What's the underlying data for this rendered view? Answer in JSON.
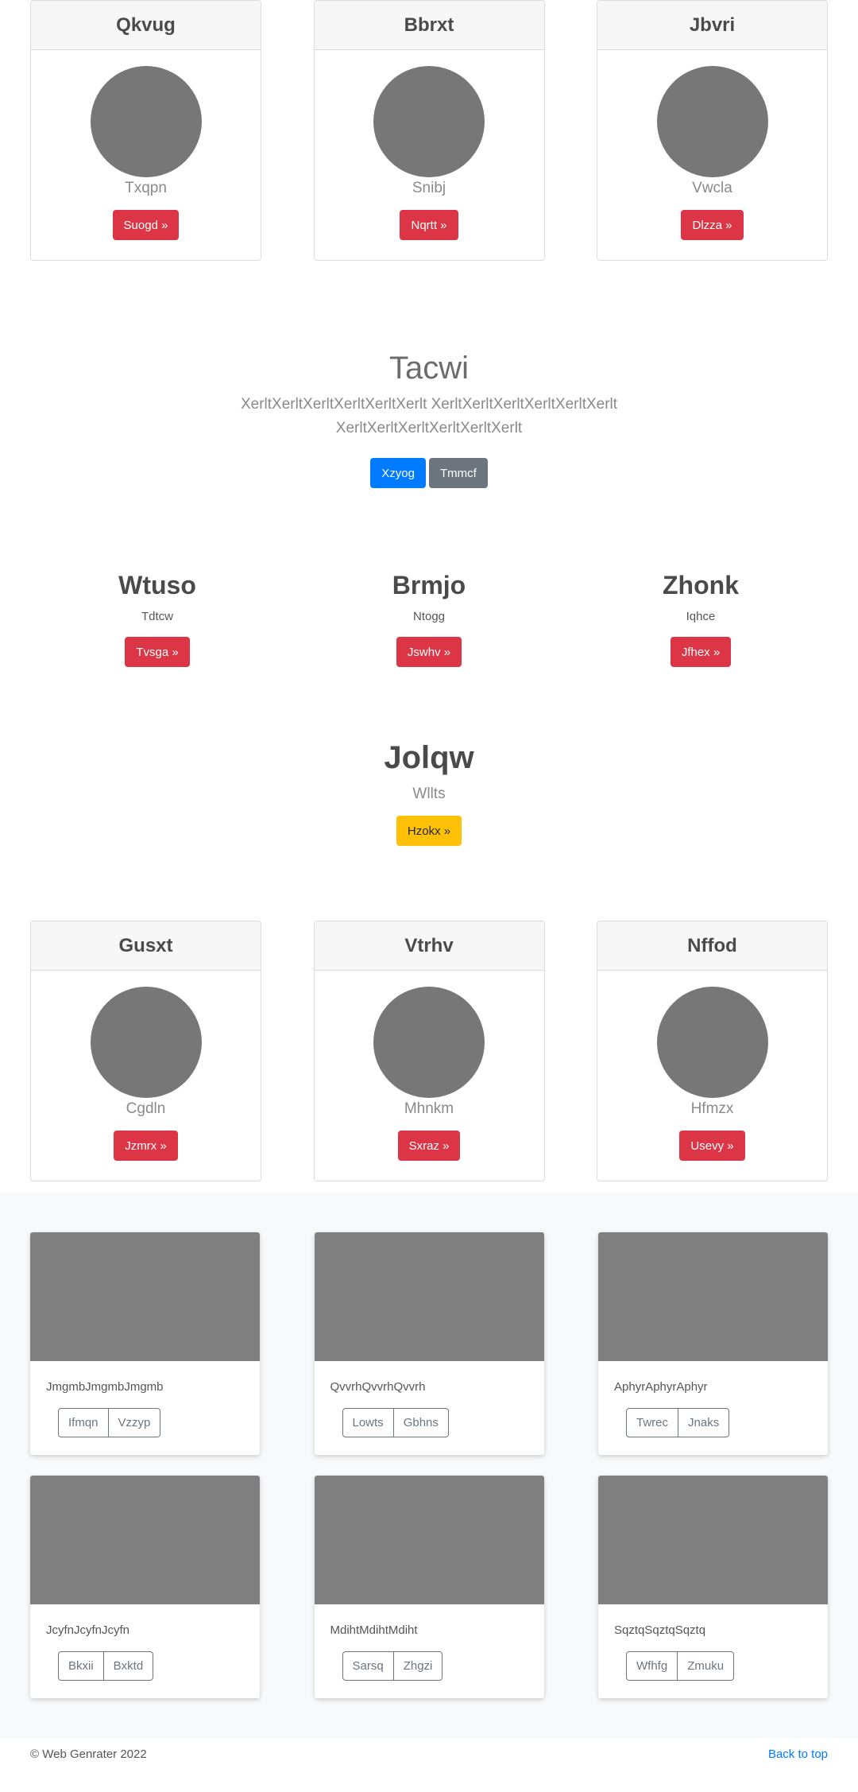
{
  "pricing_top": [
    {
      "title": "Qkvug",
      "subtitle": "Txqpn",
      "button": "Suogd »"
    },
    {
      "title": "Bbrxt",
      "subtitle": "Snibj",
      "button": "Nqrtt »"
    },
    {
      "title": "Jbvri",
      "subtitle": "Vwcla",
      "button": "Dlzza »"
    }
  ],
  "jumbotron": {
    "title": "Tacwi",
    "lead": "XerltXerltXerltXerltXerltXerlt XerltXerltXerltXerltXerltXerlt XerltXerltXerltXerltXerltXerlt",
    "primary_button": "Xzyog",
    "secondary_button": "Tmmcf"
  },
  "columns": [
    {
      "heading": "Wtuso",
      "text": "Tdtcw",
      "button": "Tvsga »"
    },
    {
      "heading": "Brmjo",
      "text": "Ntogg",
      "button": "Jswhv »"
    },
    {
      "heading": "Zhonk",
      "text": "Iqhce",
      "button": "Jfhex »"
    }
  ],
  "feature": {
    "heading": "Jolqw",
    "text": "Wllts",
    "button": "Hzokx »"
  },
  "pricing_bottom": [
    {
      "title": "Gusxt",
      "subtitle": "Cgdln",
      "button": "Jzmrx »"
    },
    {
      "title": "Vtrhv",
      "subtitle": "Mhnkm",
      "button": "Sxraz »"
    },
    {
      "title": "Nffod",
      "subtitle": "Hfmzx",
      "button": "Usevy »"
    }
  ],
  "album": [
    {
      "text": "JmgmbJmgmbJmgmb",
      "btn1": "Ifmqn",
      "btn2": "Vzzyp"
    },
    {
      "text": "QvvrhQvvrhQvvrh",
      "btn1": "Lowts",
      "btn2": "Gbhns"
    },
    {
      "text": "AphyrAphyrAphyr",
      "btn1": "Twrec",
      "btn2": "Jnaks"
    },
    {
      "text": "JcyfnJcyfnJcyfn",
      "btn1": "Bkxii",
      "btn2": "Bxktd"
    },
    {
      "text": "MdihtMdihtMdiht",
      "btn1": "Sarsq",
      "btn2": "Zhgzi"
    },
    {
      "text": "SqztqSqztqSqztq",
      "btn1": "Wfhfg",
      "btn2": "Zmuku"
    }
  ],
  "footer": {
    "copyright": "© Web Genrater 2022",
    "back_to_top": "Back to top"
  },
  "colors": {
    "danger": "#dc3545",
    "primary": "#007bff",
    "secondary": "#6c757d",
    "warning": "#ffc107",
    "placeholder": "#808080"
  }
}
